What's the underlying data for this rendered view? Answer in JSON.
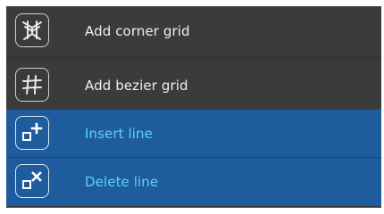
{
  "menu": {
    "items": [
      {
        "label": "Add corner grid",
        "icon": "corner-grid-icon",
        "highlighted": false
      },
      {
        "label": "Add bezier grid",
        "icon": "bezier-grid-icon",
        "highlighted": false
      },
      {
        "label": "Insert line",
        "icon": "insert-line-icon",
        "highlighted": true
      },
      {
        "label": "Delete line",
        "icon": "delete-line-icon",
        "highlighted": true
      }
    ]
  },
  "colors": {
    "background": "#3b3b3b",
    "highlight": "#1f5c9e",
    "highlight_text": "#5ad2ff",
    "text": "#f0f0f0"
  }
}
